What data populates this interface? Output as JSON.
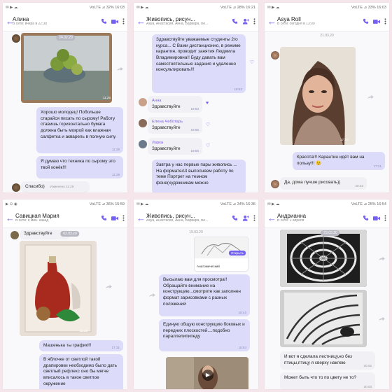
{
  "phones": [
    {
      "status": {
        "left": "✉ ▶ ☁",
        "right": "VoLTE ⊿ 32% 16:03"
      },
      "header": {
        "title": "Алина",
        "subtitle": "В сети: вчера в 22:38"
      },
      "date": "24.02.20",
      "photo_time": "11:26",
      "msgs": [
        {
          "text": "Хорошо молодец! Побольше старайся писать по сырому! Работу ставишь горизонтально бумага должна быть мокрой как влажная салфетка и акварель в полную силу",
          "time": "11:28"
        },
        {
          "text": "Я думаю что техника по сырому это твой конёк!!!",
          "time": "11:29"
        }
      ],
      "reply": {
        "text": "Спасибо)",
        "edited": "Изменено 11:29"
      }
    },
    {
      "status": {
        "left": "✉ ▶ ☁",
        "right": "VoLTE ⊿ 28% 16:21"
      },
      "header": {
        "title": "Живопись, рисун...",
        "subtitle": "Asya, Анастасия, Анна, Варвара, Ве..."
      },
      "top": {
        "text": "Здравствуйте уважаемые студенты 2го курса... С Вами дистанционно, в режиме карантин, проводит занятия Людмила Владимировна!! Буду давать вам самостоятельные задания и удаленно консультировать!!!",
        "time": "19:52"
      },
      "replies": [
        {
          "name": "Анна",
          "text": "Здравствуйте",
          "time": "19:53"
        },
        {
          "name": "Елена Чеботарь",
          "text": "Здравствуйте",
          "time": "19:56"
        },
        {
          "name": "Ларка",
          "text": "Здравствуйте",
          "time": "19:56"
        }
      ],
      "bottom": {
        "text": "Завтра у нас первые пары живопись ... На форматеА3 выполняем работу по теме Портрет на темном фоне(художникам можно"
      }
    },
    {
      "status": {
        "left": "✉ ▶ ☁",
        "right": "VoLTE ⊿ 33% 16:03"
      },
      "header": {
        "title": "Asya Roll",
        "subtitle": "В сети: сегодня в 13:09"
      },
      "date": "21.03.20",
      "photo_time": "17:20",
      "out": {
        "text": "Красота!!! Карантин идёт вам на пользу!!! 😉",
        "time": "17:21"
      },
      "in": {
        "text": "Да, дома лучше рисовать))",
        "time": "20:33"
      }
    },
    {
      "status": {
        "left": "▶ ⊙ ◉",
        "right": "VoLTE ⊿ 36% 15:59"
      },
      "header": {
        "title": "Савицкая Мария",
        "subtitle": "В сети: 8 мин. назад"
      },
      "greet": "Здравствуйте",
      "date": "02.03.20",
      "photo_time": "11:28",
      "msgs": [
        {
          "text": "Машенька ты график!!!",
          "time": "17:31"
        },
        {
          "text": "В яблочке от светлой такой драпировки необходимо было дать светлый рефлекс оно бы мягче вписалось в такое светлое окружение",
          "time": ""
        }
      ]
    },
    {
      "status": {
        "left": "✉ ▶ ☁",
        "right": "VoLTE ⊿ 34% 16:36"
      },
      "header": {
        "title": "Живопись, рисун...",
        "subtitle": "Asya, Анастасия, Анна, Варвара, Ве..."
      },
      "date": "19.03.20",
      "file": {
        "name": "Анатомический",
        "btn": "Открыть"
      },
      "msgs": [
        {
          "text": "Высылаю вам для просмотра!! Обращайте внимание на конструкцию...смотрите как заполнен формат зарисовками с разных положений",
          "time": "18:43"
        },
        {
          "text": "Единую общую конструкцию боковых и передних плоскостей....подобно параллелипипеду",
          "time": "18:53"
        }
      ]
    },
    {
      "status": {
        "left": "✉ ▶ ☁",
        "right": "VoLTE ⊿ 25% 16:54"
      },
      "header": {
        "title": "Андрианна",
        "subtitle": "В сети: 2 апреля"
      },
      "date": "23.03.20",
      "msgs": [
        {
          "text": "И вот я сделала лестницу,но без птицы,птицу я сверху наклею",
          "time": "20:02"
        },
        {
          "text": "Может быть что то по цвету не то?",
          "time": "20:03"
        }
      ]
    }
  ],
  "colors": {
    "accent": "#7360f2",
    "outgoing": "#dcdcfa",
    "incoming": "#f1f1f5"
  }
}
